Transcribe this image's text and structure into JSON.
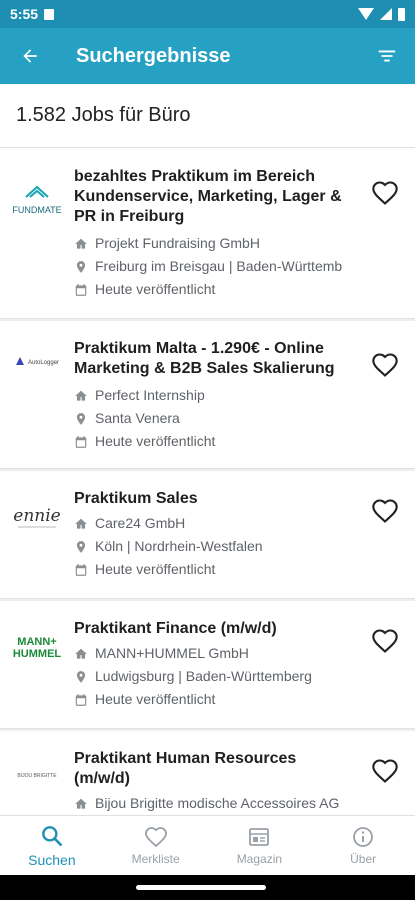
{
  "status_bar": {
    "time": "5:55"
  },
  "app_bar": {
    "title": "Suchergebnisse"
  },
  "result_count": "1.582 Jobs für Büro",
  "jobs": [
    {
      "title": "bezahltes Praktikum im Bereich Kundenservice, Marketing, Lager & PR in Freiburg",
      "company": "Projekt Fundraising GmbH",
      "location": "Freiburg im Breisgau | Baden-Württemb",
      "posted": "Heute veröffentlicht",
      "logo_text": "FUNDMATE"
    },
    {
      "title": "Praktikum Malta - 1.290€ - Online Marketing & B2B Sales Skalierung",
      "company": "Perfect Internship",
      "location": "Santa Venera",
      "posted": "Heute veröffentlicht",
      "logo_text": "AutoLogger"
    },
    {
      "title": "Praktikum Sales",
      "company": "Care24 GmbH",
      "location": "Köln | Nordrhein-Westfalen",
      "posted": "Heute veröffentlicht",
      "logo_text": "ennie"
    },
    {
      "title": "Praktikant Finance (m/w/d)",
      "company": "MANN+HUMMEL GmbH",
      "location": "Ludwigsburg | Baden-Württemberg",
      "posted": "Heute veröffentlicht",
      "logo_text": "MANN+ HUMMEL"
    },
    {
      "title": "Praktikant Human Resources (m/w/d)",
      "company": "Bijou Brigitte modische Accessoires AG",
      "logo_text": "BIJOU BRIGITTE"
    }
  ],
  "bottom_nav": [
    {
      "label": "Suchen",
      "icon": "search-icon",
      "active": true
    },
    {
      "label": "Merkliste",
      "icon": "heart-icon",
      "active": false
    },
    {
      "label": "Magazin",
      "icon": "magazine-icon",
      "active": false
    },
    {
      "label": "Über",
      "icon": "info-icon",
      "active": false
    }
  ],
  "colors": {
    "status_bar": "#1e8fb3",
    "app_bar": "#26a1c4",
    "accent": "#1e8fb3",
    "meta_text": "#5f6368"
  }
}
